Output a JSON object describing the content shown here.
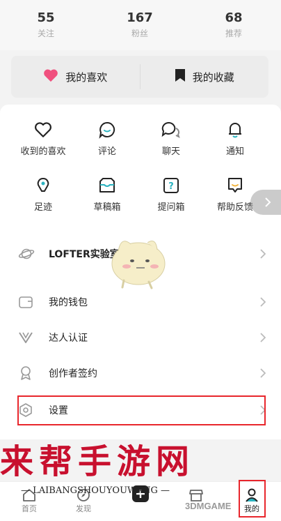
{
  "stats": [
    {
      "num": "55",
      "label": "关注"
    },
    {
      "num": "167",
      "label": "粉丝"
    },
    {
      "num": "68",
      "label": "推荐"
    }
  ],
  "fav_card": {
    "likes_label": "我的喜欢",
    "collections_label": "我的收藏"
  },
  "grid": [
    {
      "label": "收到的喜欢",
      "icon": "heart-outline-icon"
    },
    {
      "label": "评论",
      "icon": "comment-icon"
    },
    {
      "label": "聊天",
      "icon": "chat-icon"
    },
    {
      "label": "通知",
      "icon": "bell-icon"
    },
    {
      "label": "足迹",
      "icon": "footprint-icon"
    },
    {
      "label": "草稿箱",
      "icon": "draft-box-icon"
    },
    {
      "label": "提问箱",
      "icon": "question-box-icon"
    },
    {
      "label": "帮助反馈",
      "icon": "help-feedback-icon"
    }
  ],
  "menu": [
    {
      "label": "LOFTER实验室",
      "icon": "planet-icon"
    },
    {
      "label": "我的钱包",
      "icon": "wallet-icon"
    },
    {
      "label": "达人认证",
      "icon": "v-badge-icon"
    },
    {
      "label": "创作者签约",
      "icon": "award-icon"
    },
    {
      "label": "设置",
      "icon": "settings-hex-icon"
    }
  ],
  "tabbar": [
    {
      "label": "首页",
      "icon": "home-icon"
    },
    {
      "label": "发现",
      "icon": "discover-icon"
    },
    {
      "label": "",
      "icon": "plus-icon"
    },
    {
      "label": "",
      "icon": "shop-icon"
    },
    {
      "label": "我的",
      "icon": "profile-icon",
      "active": true
    }
  ],
  "watermark": {
    "main": "来帮手游网",
    "sub": "— LAIBANGSHOUYOUWANG —",
    "brand": "3DMGAME"
  },
  "colors": {
    "heart": "#f0507e",
    "highlight": "#e8262c",
    "watermark": "#c8102e"
  }
}
